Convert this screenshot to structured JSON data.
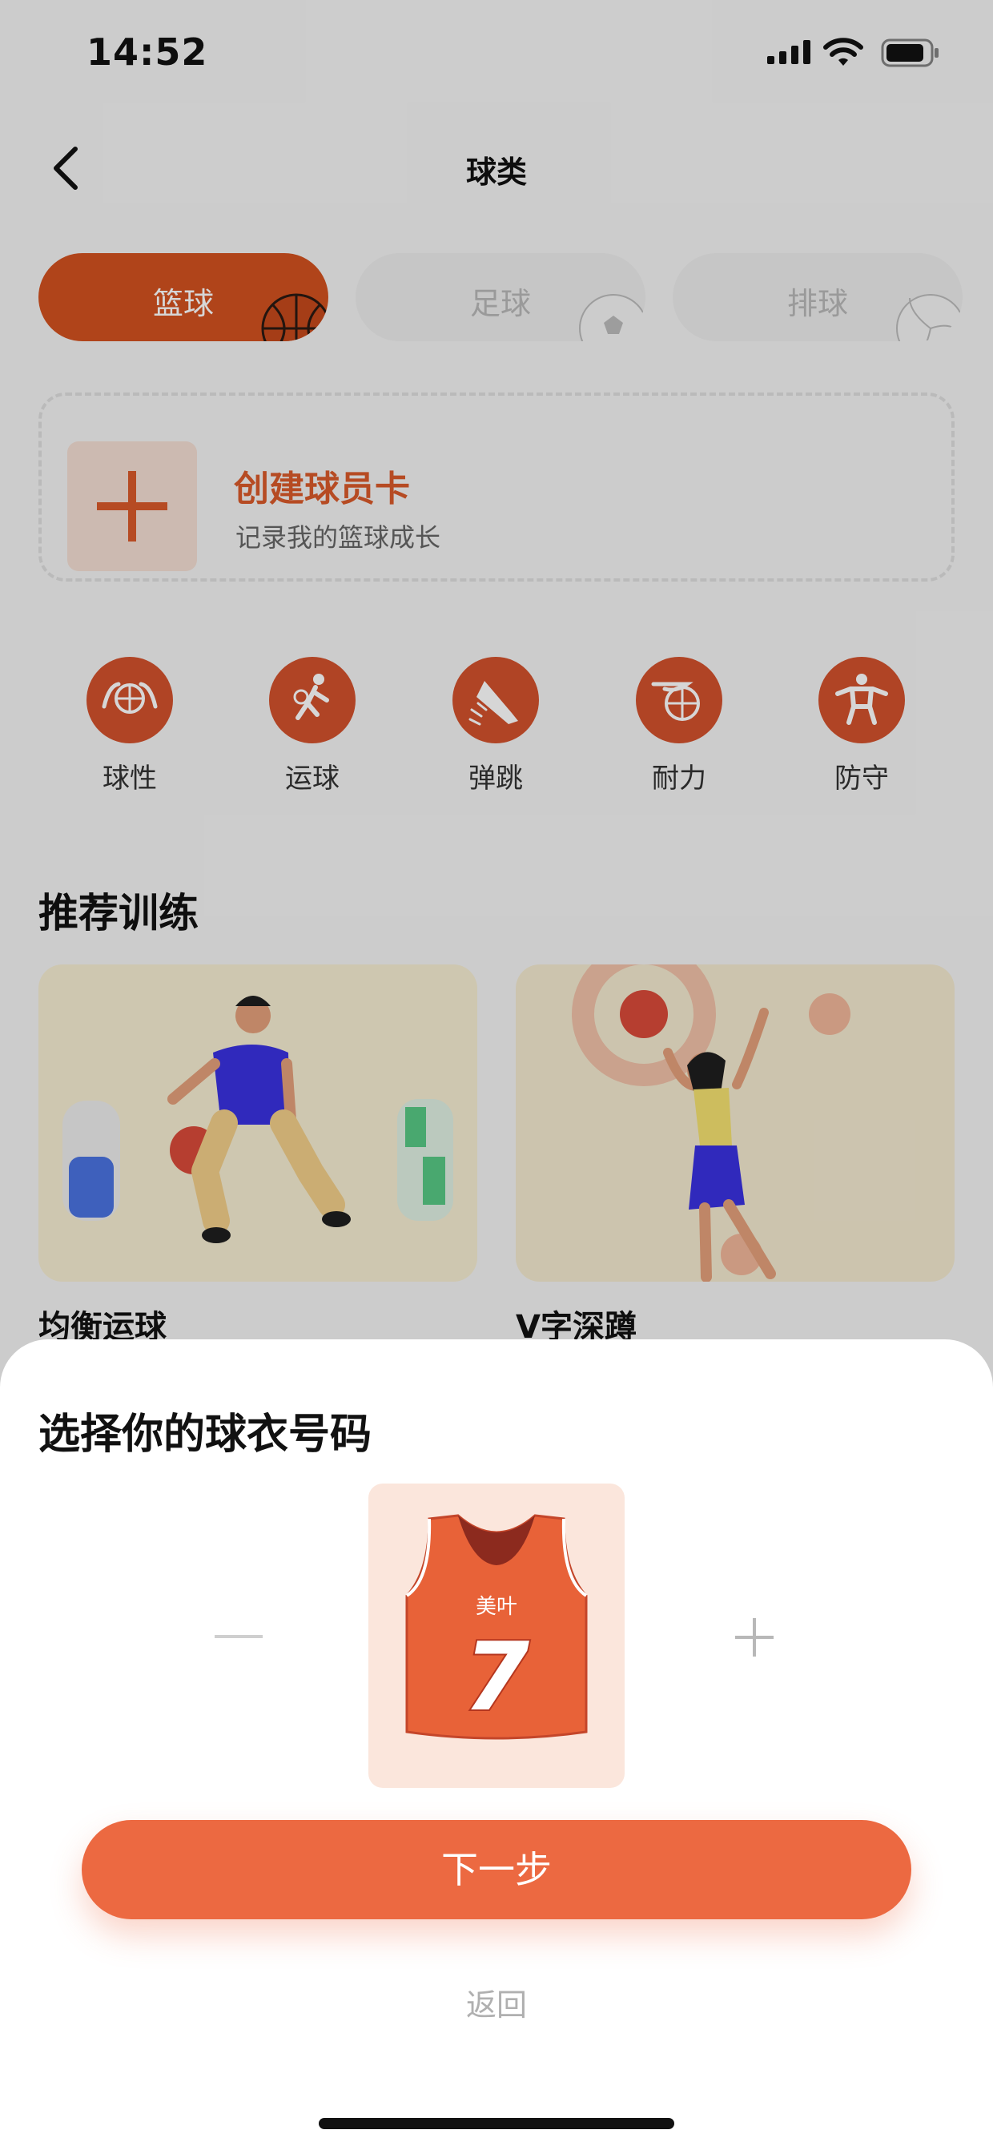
{
  "status_bar": {
    "time": "14:52"
  },
  "header": {
    "title": "球类"
  },
  "tabs": [
    {
      "label": "篮球",
      "active": true
    },
    {
      "label": "足球",
      "active": false
    },
    {
      "label": "排球",
      "active": false
    }
  ],
  "create_card": {
    "title": "创建球员卡",
    "subtitle": "记录我的篮球成长"
  },
  "categories": [
    {
      "label": "球性",
      "icon": "ball-hands-icon"
    },
    {
      "label": "运球",
      "icon": "dribble-icon"
    },
    {
      "label": "弹跳",
      "icon": "jump-shoe-icon"
    },
    {
      "label": "耐力",
      "icon": "endurance-icon"
    },
    {
      "label": "防守",
      "icon": "defense-icon"
    }
  ],
  "recommend": {
    "title": "推荐训练",
    "items": [
      {
        "name": "均衡运球"
      },
      {
        "name": "V字深蹲"
      }
    ]
  },
  "sheet": {
    "title": "选择你的球衣号码",
    "jersey": {
      "name": "美叶",
      "number": "7"
    },
    "next_label": "下一步",
    "back_label": "返回"
  },
  "colors": {
    "accent": "#ec6941",
    "brand": "#d2511f",
    "sheet_bg": "#ffffff"
  }
}
